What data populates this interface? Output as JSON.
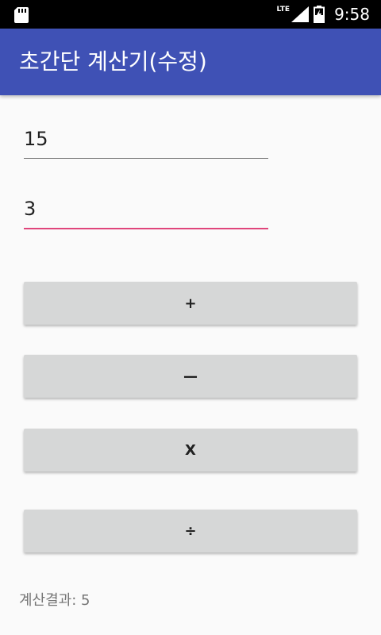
{
  "status_bar": {
    "time": "9:58",
    "network": "LTE",
    "icons": [
      "sd-card-icon",
      "signal-icon",
      "battery-charging-icon"
    ]
  },
  "app_bar": {
    "title": "초간단 계산기(수정)"
  },
  "inputs": {
    "first_value": "15",
    "second_value": "3",
    "accent_color": "#e0457b"
  },
  "buttons": {
    "plus": "+",
    "minus": "—",
    "multiply": "X",
    "divide": "÷"
  },
  "result": {
    "label": "계산결과: ",
    "value": "5"
  },
  "colors": {
    "primary": "#3f51b5",
    "status_bar": "#000000",
    "button_bg": "#d6d7d7",
    "background": "#fafafa"
  }
}
